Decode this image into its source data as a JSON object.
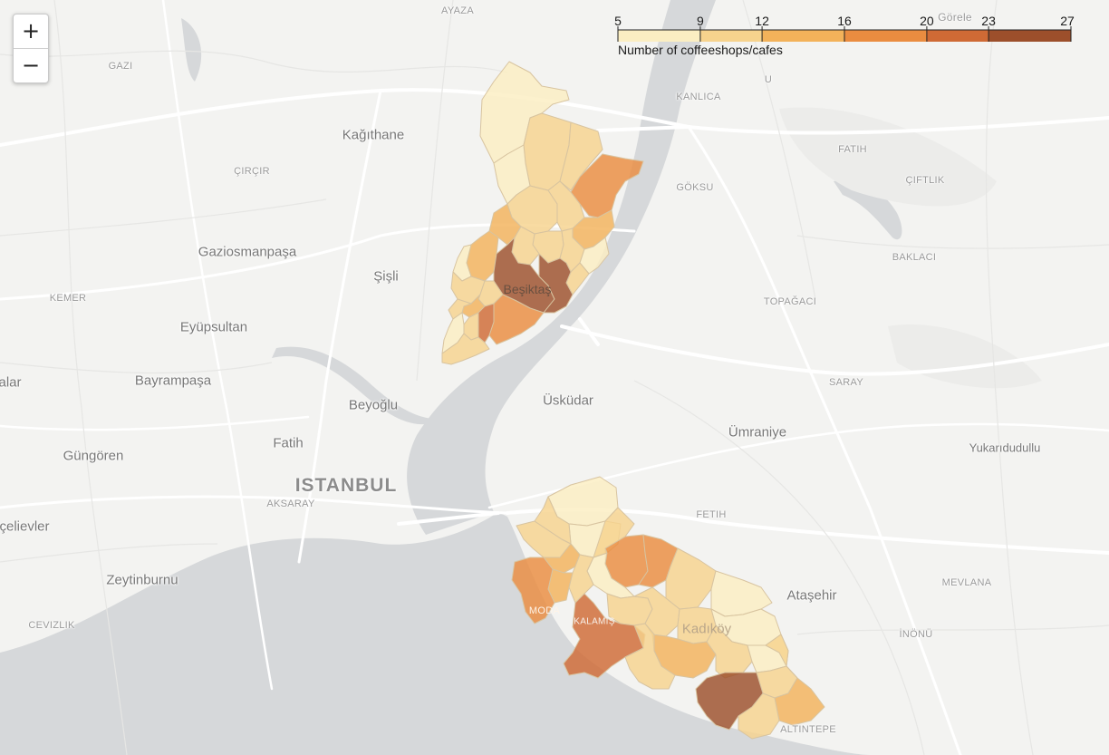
{
  "map": {
    "controls": {
      "zoom_in": "+",
      "zoom_out": "−"
    },
    "legend": {
      "title": "Number of coffeeshops/cafes",
      "ticks": [
        5,
        9,
        12,
        16,
        20,
        23,
        27
      ],
      "colors": [
        "#fbeec2",
        "#f7d38d",
        "#f3b25a",
        "#ea8c40",
        "#cf6a35",
        "#9c4f2b"
      ]
    },
    "place_labels": {
      "ayaza": "AYAZA",
      "gorele": "Görele",
      "gazi": "GAZI",
      "kanlica": "KANLICA",
      "u": "U",
      "kagithane": "Kağıthane",
      "fatih_east": "FATIH",
      "cirpir": "ÇIRÇIR",
      "ciftlik": "ÇIFTLIK",
      "goksu": "GÖKSU",
      "gaziosmanpasa": "Gaziosmanpaşa",
      "baklaci": "BAKLACI",
      "sisli": "Şişli",
      "kemer": "KEMER",
      "besiktas": "Beşiktaş",
      "topagaci": "TOPAĞACI",
      "eyupsultan": "Eyüpsultan",
      "alar": "alar",
      "bayrampasa": "Bayrampaşa",
      "saray": "SARAY",
      "beyoglu": "Beyoğlu",
      "uskudar": "Üsküdar",
      "umraniye": "Ümraniye",
      "fatih": "Fatih",
      "yukaridudullu": "Yukarıdudullu",
      "gungoren": "Güngören",
      "istanbul": "ISTANBUL",
      "aksaray": "AKSARAY",
      "fetih": "FETIH",
      "celievler": "çelievler",
      "zeytinburnu": "Zeytinburnu",
      "mevlana": "MEVLANA",
      "moda": "MODA",
      "atasehir": "Ataşehir",
      "kalamis": "KALAMIŞ",
      "kadikoy": "Kadıköy",
      "cevizlik": "CEVIZLIK",
      "inonu": "İNÖNÜ",
      "altintepe": "ALTINTEPE"
    },
    "districts": [
      {
        "name": "Beşiktaş",
        "neighborhood_values": [
          6,
          11,
          8,
          11,
          17,
          11,
          10,
          12,
          13,
          9,
          10,
          13,
          8,
          11,
          11,
          7,
          11,
          23,
          24,
          11,
          16,
          14,
          10,
          22,
          11,
          8,
          10
        ]
      },
      {
        "name": "Kadıköy",
        "neighborhood_values": [
          8,
          8,
          10,
          11,
          12,
          17,
          19,
          7,
          10,
          11,
          12,
          11,
          16,
          5,
          11,
          10,
          9,
          8,
          12,
          9,
          6,
          22,
          10,
          9,
          23,
          12,
          11,
          9
        ]
      }
    ]
  }
}
